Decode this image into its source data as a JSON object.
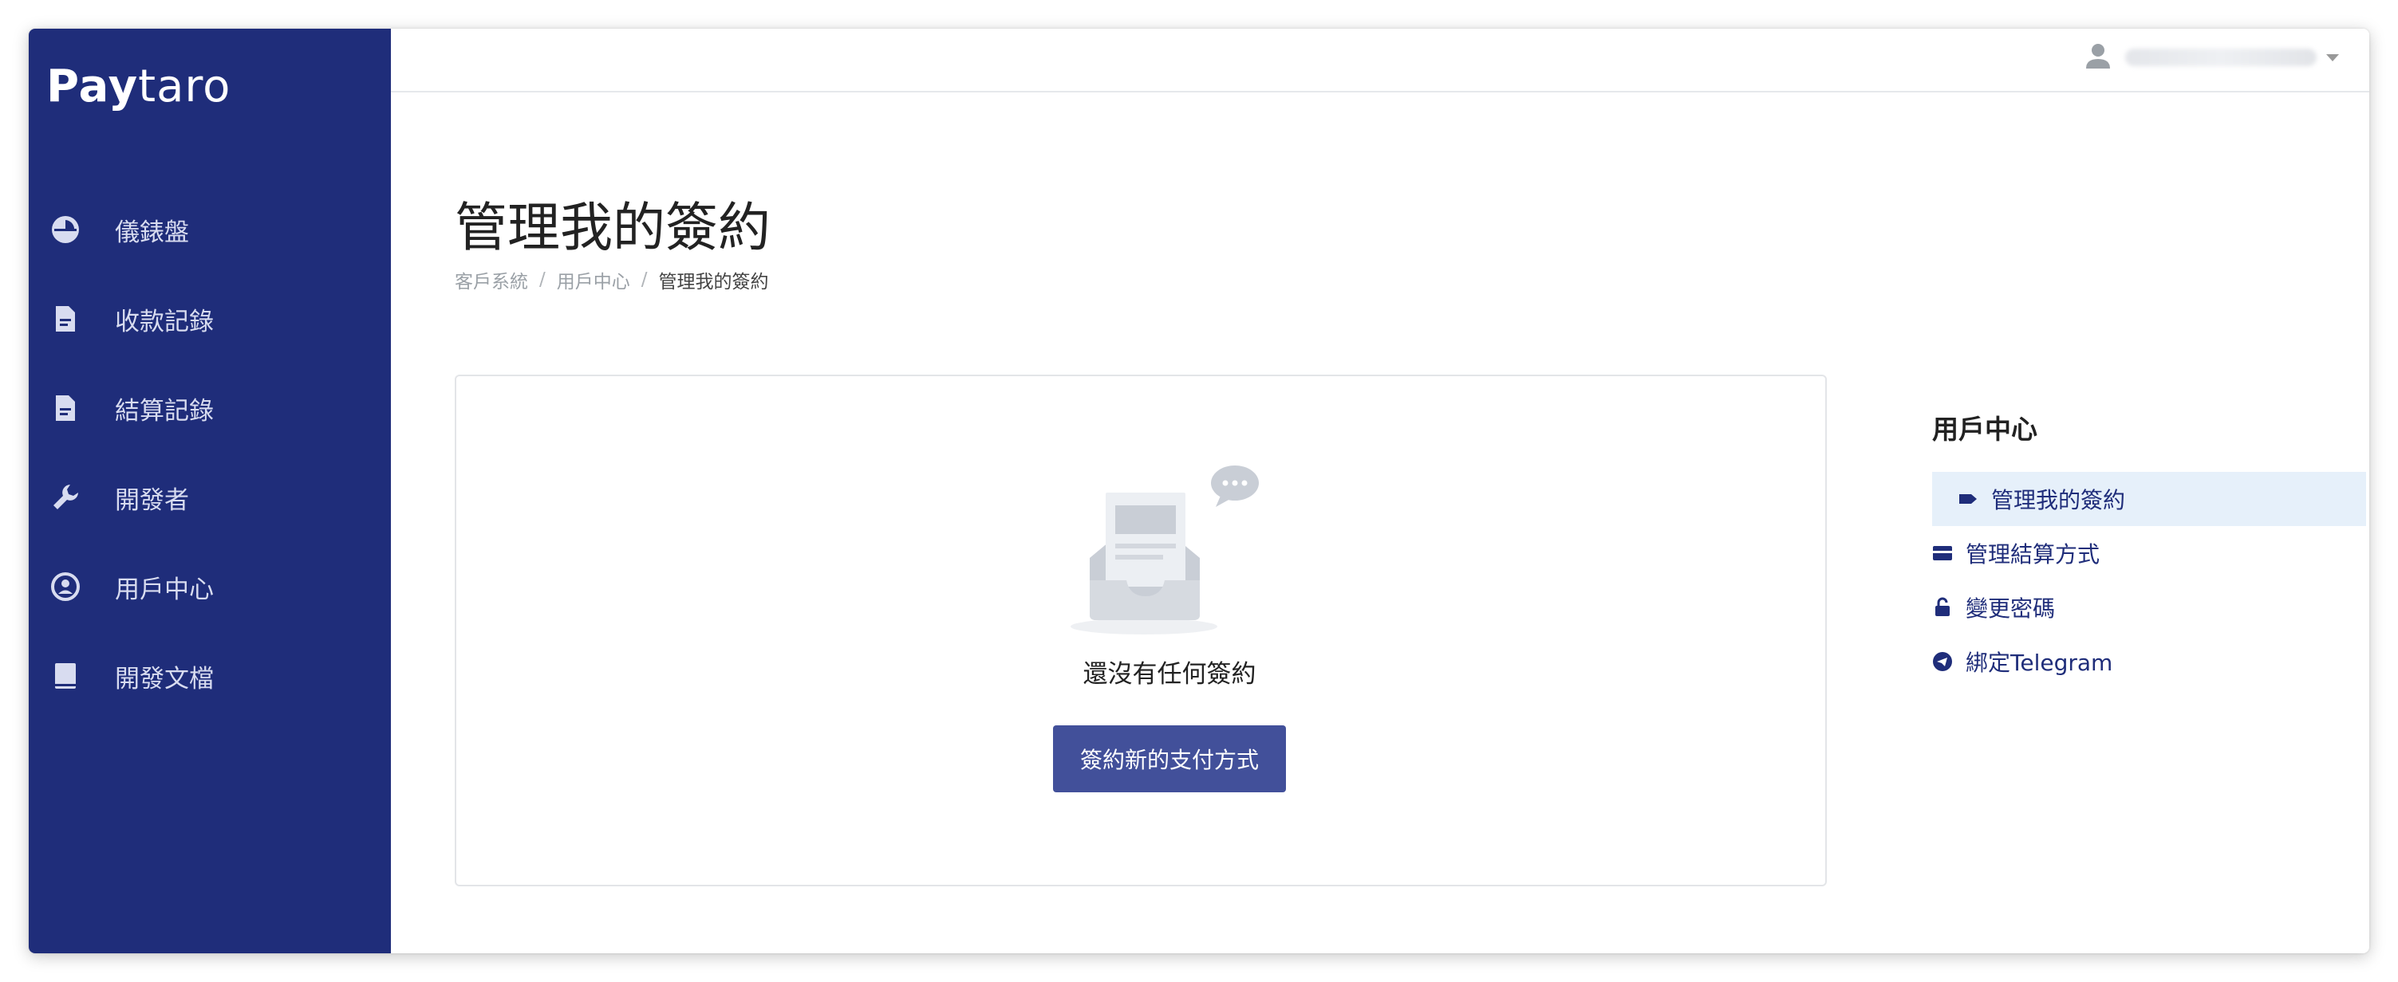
{
  "app": {
    "logo_bold": "Pay",
    "logo_light": "taro"
  },
  "sidebar": {
    "items": [
      {
        "label": "儀錶盤",
        "icon": "dashboard-icon"
      },
      {
        "label": "收款記錄",
        "icon": "document-icon"
      },
      {
        "label": "結算記錄",
        "icon": "document-icon"
      },
      {
        "label": "開發者",
        "icon": "wrench-icon"
      },
      {
        "label": "用戶中心",
        "icon": "user-circle-icon"
      },
      {
        "label": "開發文檔",
        "icon": "book-icon"
      }
    ]
  },
  "topbar": {
    "user_icon": "user-icon",
    "user_name": ""
  },
  "page": {
    "title": "管理我的簽約",
    "breadcrumb": [
      "客戶系統",
      "用戶中心",
      "管理我的簽約"
    ],
    "breadcrumb_separator": "/"
  },
  "empty_state": {
    "message": "還沒有任何簽約",
    "button_label": "簽約新的支付方式",
    "illustration_icon": "empty-inbox-icon"
  },
  "user_center_menu": {
    "title": "用戶中心",
    "items": [
      {
        "label": "管理我的簽約",
        "icon": "tag-icon",
        "active": true
      },
      {
        "label": "管理結算方式",
        "icon": "credit-card-icon",
        "active": false
      },
      {
        "label": "變更密碼",
        "icon": "lock-icon",
        "active": false
      },
      {
        "label": "綁定Telegram",
        "icon": "telegram-icon",
        "active": false
      }
    ]
  },
  "colors": {
    "sidebar_bg": "#1f2d7a",
    "primary_button": "#42509a",
    "active_menu_bg": "#e6f0fa",
    "link": "#1f2d7a"
  }
}
